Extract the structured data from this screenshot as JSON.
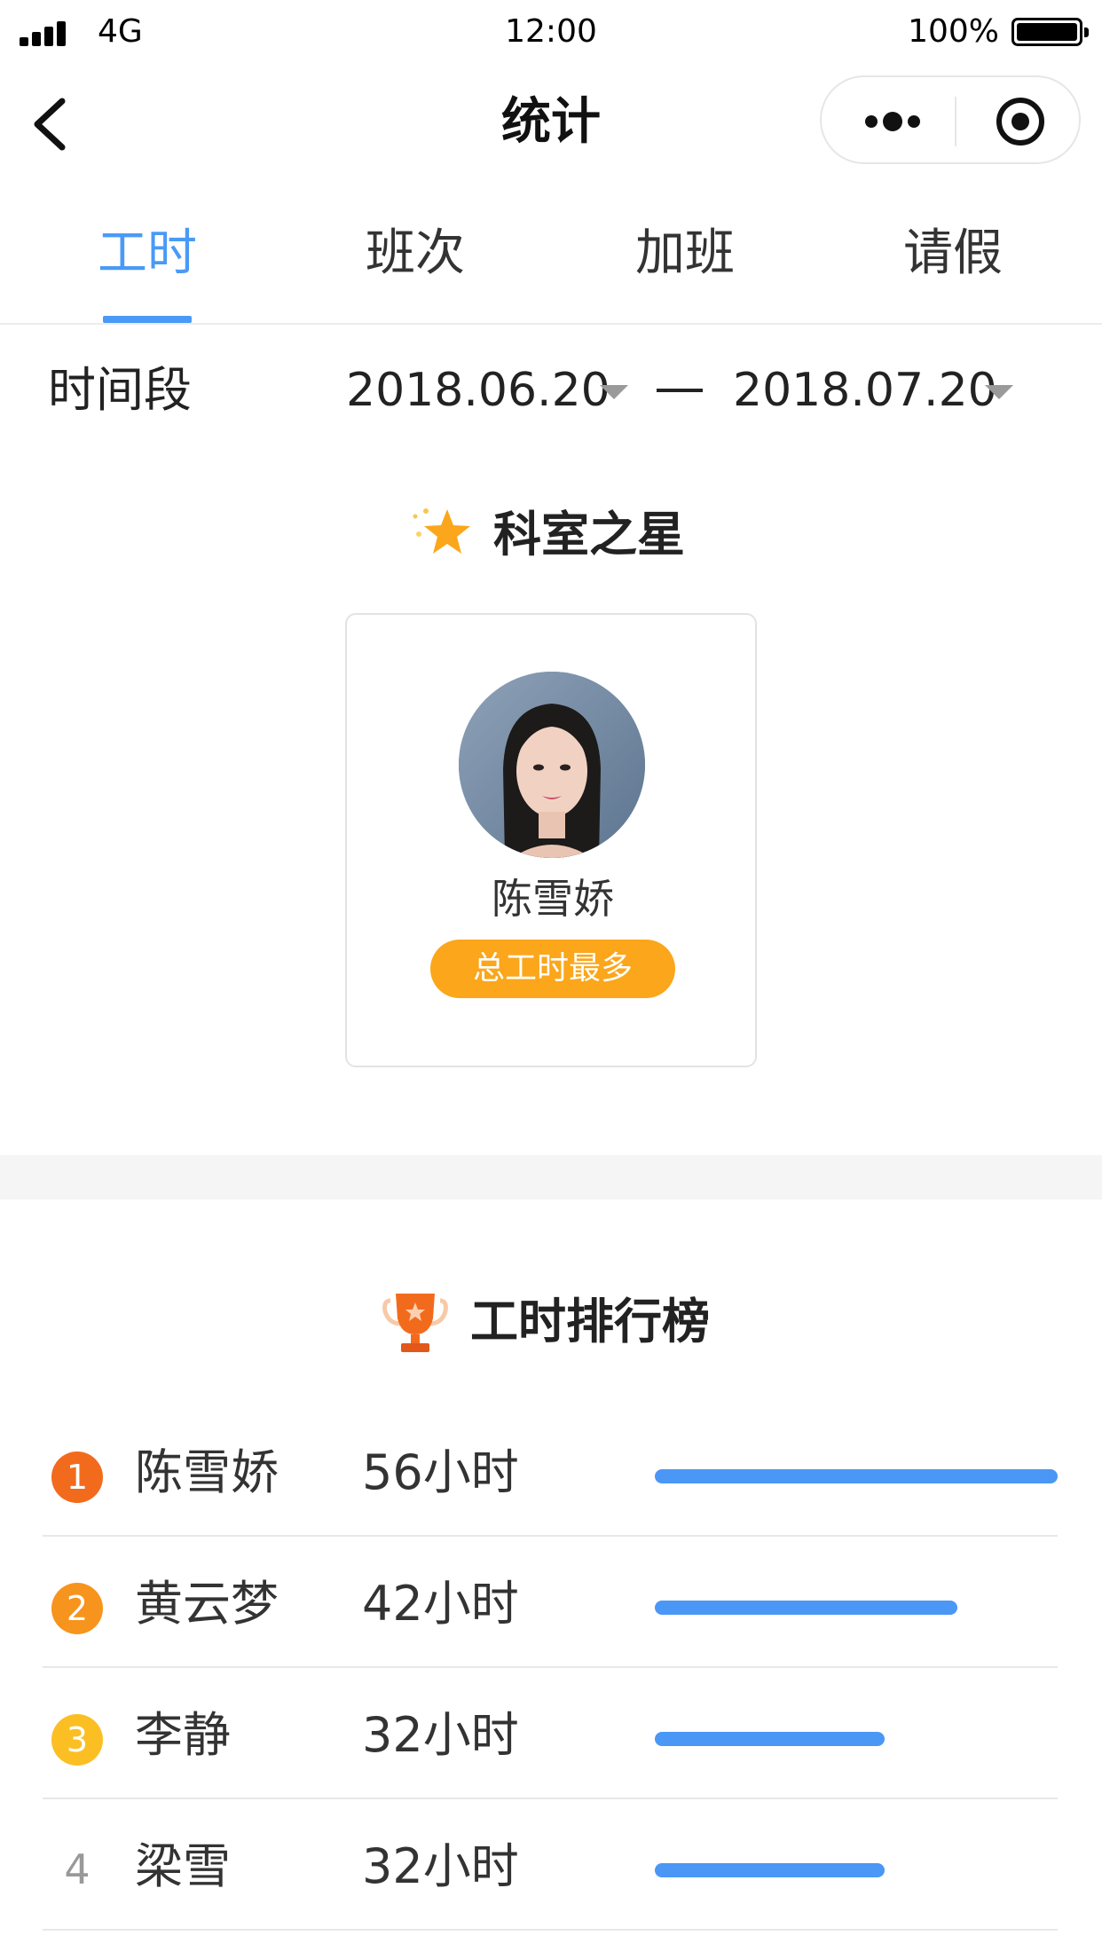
{
  "status_bar": {
    "network": "4G",
    "time": "12:00",
    "battery": "100%"
  },
  "nav": {
    "title": "统计"
  },
  "tabs": [
    {
      "label": "工时",
      "active": true
    },
    {
      "label": "班次",
      "active": false
    },
    {
      "label": "加班",
      "active": false
    },
    {
      "label": "请假",
      "active": false
    }
  ],
  "period": {
    "label": "时间段",
    "start": "2018.06.20",
    "end": "2018.07.20"
  },
  "star": {
    "title": "科室之星",
    "name": "陈雪娇",
    "badge": "总工时最多"
  },
  "ranking": {
    "title": "工时排行榜",
    "max_hours": 56,
    "rows": [
      {
        "rank": "1",
        "name": "陈雪娇",
        "hours": "56小时",
        "value": 56,
        "badge_color": "#f26b1d"
      },
      {
        "rank": "2",
        "name": "黄云梦",
        "hours": "42小时",
        "value": 42,
        "badge_color": "#f7941d"
      },
      {
        "rank": "3",
        "name": "李静",
        "hours": "32小时",
        "value": 32,
        "badge_color": "#fbbf24"
      },
      {
        "rank": "4",
        "name": "梁雪",
        "hours": "32小时",
        "value": 32,
        "badge_color": ""
      }
    ]
  },
  "colors": {
    "accent": "#4a9af5",
    "badge": "#fba61b",
    "bar": "#4a97f5"
  }
}
